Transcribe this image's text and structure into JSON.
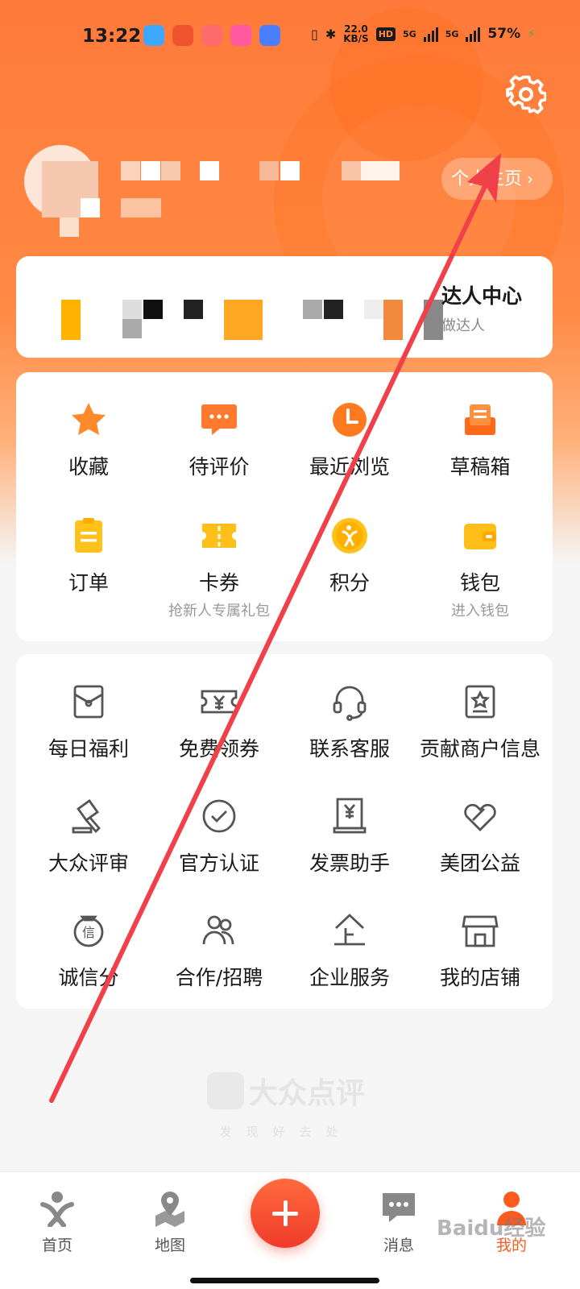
{
  "status_bar": {
    "time": "13:22",
    "net_speed_value": "22.0",
    "net_speed_unit": "KB/S",
    "hd_badge": "HD",
    "signal1_label": "5G",
    "signal2_label": "5G",
    "battery": "57%"
  },
  "profile": {
    "homepage_link": "个人主页",
    "homepage_chevron": "›"
  },
  "talent": {
    "title": "达人中心",
    "subtitle": "做达人"
  },
  "quick_grid": [
    {
      "label": "收藏",
      "sub": ""
    },
    {
      "label": "待评价",
      "sub": ""
    },
    {
      "label": "最近浏览",
      "sub": ""
    },
    {
      "label": "草稿箱",
      "sub": ""
    },
    {
      "label": "订单",
      "sub": ""
    },
    {
      "label": "卡券",
      "sub": "抢新人专属礼包"
    },
    {
      "label": "积分",
      "sub": ""
    },
    {
      "label": "钱包",
      "sub": "进入钱包"
    }
  ],
  "services": [
    {
      "label": "每日福利"
    },
    {
      "label": "免费领券"
    },
    {
      "label": "联系客服"
    },
    {
      "label": "贡献商户信息"
    },
    {
      "label": "大众评审"
    },
    {
      "label": "官方认证"
    },
    {
      "label": "发票助手"
    },
    {
      "label": "美团公益"
    },
    {
      "label": "诚信分"
    },
    {
      "label": "合作/招聘"
    },
    {
      "label": "企业服务"
    },
    {
      "label": "我的店铺"
    }
  ],
  "brand": {
    "name": "大众点评",
    "tagline": "发现好去处"
  },
  "tabbar": {
    "home": "首页",
    "map": "地图",
    "messages": "消息",
    "mine": "我的"
  },
  "watermark": "Baidu经验",
  "colors": {
    "accent": "#ff7a3a",
    "tab_active": "#ff5b1f",
    "annotation_arrow": "#f0414a"
  }
}
